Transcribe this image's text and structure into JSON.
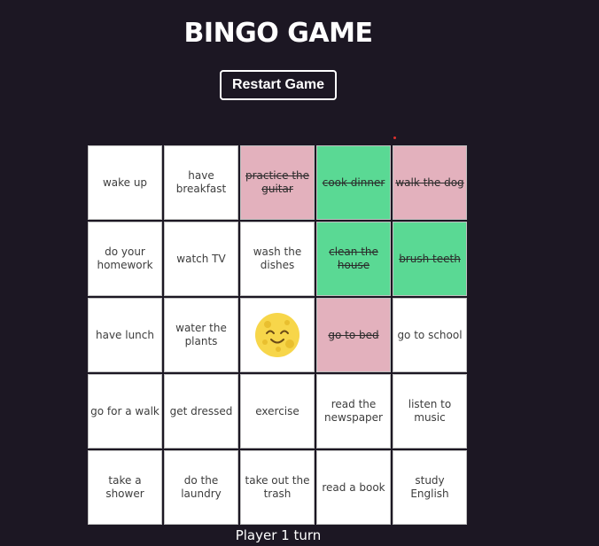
{
  "title": "BINGO GAME",
  "restart_label": "Restart Game",
  "turn_text": "Player 1 turn",
  "colors": {
    "background": "#1c1723",
    "marked_player_pink": "#e3b1bd",
    "marked_player_green": "#5ad994",
    "cell": "#ffffff"
  },
  "center_icon": "smiling-moon-face-icon",
  "cells": [
    {
      "label": "wake up",
      "state": "none"
    },
    {
      "label": "have breakfast",
      "state": "none"
    },
    {
      "label": "practice the guitar",
      "state": "pink"
    },
    {
      "label": "cook dinner",
      "state": "green"
    },
    {
      "label": "walk the dog",
      "state": "pink"
    },
    {
      "label": "do your homework",
      "state": "none"
    },
    {
      "label": "watch TV",
      "state": "none"
    },
    {
      "label": "wash the dishes",
      "state": "none"
    },
    {
      "label": "clean the house",
      "state": "green"
    },
    {
      "label": "brush teeth",
      "state": "green"
    },
    {
      "label": "have lunch",
      "state": "none"
    },
    {
      "label": "water the plants",
      "state": "none"
    },
    {
      "label": "",
      "state": "center"
    },
    {
      "label": "go to bed",
      "state": "pink"
    },
    {
      "label": "go to school",
      "state": "none"
    },
    {
      "label": "go for a walk",
      "state": "none"
    },
    {
      "label": "get dressed",
      "state": "none"
    },
    {
      "label": "exercise",
      "state": "none"
    },
    {
      "label": "read the newspaper",
      "state": "none"
    },
    {
      "label": "listen to music",
      "state": "none"
    },
    {
      "label": "take a shower",
      "state": "none"
    },
    {
      "label": "do the laundry",
      "state": "none"
    },
    {
      "label": "take out the trash",
      "state": "none"
    },
    {
      "label": "read a book",
      "state": "none"
    },
    {
      "label": "study English",
      "state": "none"
    }
  ]
}
